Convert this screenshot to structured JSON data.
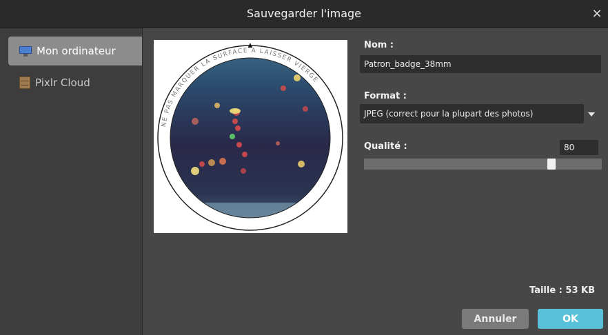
{
  "window": {
    "title": "Sauvegarder l'image",
    "close_glyph": "×"
  },
  "sidebar": {
    "items": [
      {
        "label": "Mon ordinateur",
        "icon": "monitor-icon",
        "active": true
      },
      {
        "label": "Pixlr Cloud",
        "icon": "cabinet-icon",
        "active": false
      }
    ]
  },
  "preview": {
    "ring_text": "NE PAS MARQUER LA SURFACE A LAISSER VIERGE",
    "marker": "▲"
  },
  "form": {
    "name_label": "Nom :",
    "name_value": "Patron_badge_38mm",
    "format_label": "Format :",
    "format_value": "JPEG (correct pour la plupart des photos)",
    "quality_label": "Qualité :",
    "quality_value": "80",
    "quality_fraction": 0.8
  },
  "size_text": "Taille : 53 KB",
  "buttons": {
    "cancel": "Annuler",
    "ok": "OK"
  },
  "colors": {
    "ok_button": "#59c0d9",
    "active_item": "#8c8c8c"
  }
}
